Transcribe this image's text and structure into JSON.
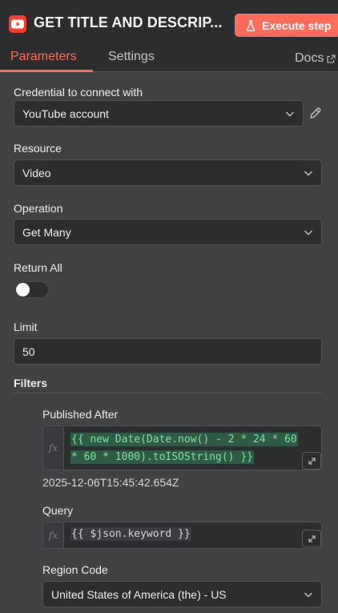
{
  "header": {
    "node_title": "GET TITLE AND DESCRIP...",
    "execute_label": "Execute step",
    "tabs": [
      {
        "label": "Parameters",
        "active": true
      },
      {
        "label": "Settings",
        "active": false
      }
    ],
    "docs_label": "Docs"
  },
  "params": {
    "credential": {
      "label": "Credential to connect with",
      "value": "YouTube account"
    },
    "resource": {
      "label": "Resource",
      "value": "Video"
    },
    "operation": {
      "label": "Operation",
      "value": "Get Many"
    },
    "return_all": {
      "label": "Return All",
      "enabled": false
    },
    "limit": {
      "label": "Limit",
      "value": "50"
    },
    "filters": {
      "title": "Filters",
      "published_after": {
        "label": "Published After",
        "expression_line1": "{{ new Date(Date.now() - 2 * 24 * 60",
        "expression_line2": "* 60 * 1000).toISOString() }}",
        "result": "2025-12-06T15:45:42.654Z"
      },
      "query": {
        "label": "Query",
        "expression": "{{ $json.keyword }}"
      },
      "region_code": {
        "label": "Region Code",
        "value": "United States of America (the) - US"
      }
    }
  },
  "icons": {
    "node": "youtube-icon",
    "execute": "flask-icon",
    "docs": "external-link-icon",
    "edit": "pencil-icon",
    "dropdown": "chevron-down-icon",
    "expand": "expand-icon"
  },
  "colors": {
    "accent": "#ff6d5a",
    "youtube_red": "#ff3b30",
    "panel_bg": "#414244",
    "field_bg": "#2c2d2f",
    "expr_highlight": "#2f5b46"
  }
}
